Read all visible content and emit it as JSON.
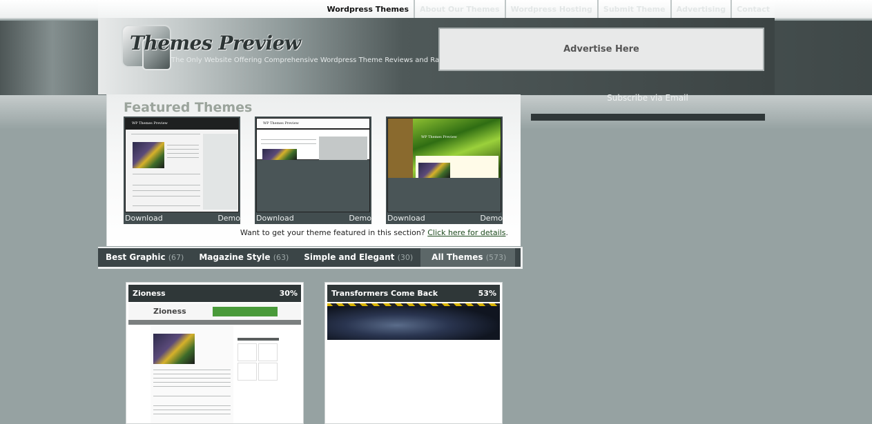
{
  "top_nav": {
    "items": [
      {
        "label": "Wordpress Themes",
        "active": true
      },
      {
        "label": "About Our Themes",
        "active": false
      },
      {
        "label": "Wordpress Hosting",
        "active": false
      },
      {
        "label": "Submit Theme",
        "active": false
      },
      {
        "label": "Advertising",
        "active": false
      },
      {
        "label": "Contact",
        "active": false
      }
    ]
  },
  "header": {
    "logo_title": "Themes Preview",
    "tagline": "The Only Website Offering Comprehensive Wordpress Theme Reviews and Ratings",
    "advert": "Advertise Here"
  },
  "featured": {
    "title": "Featured Themes",
    "cards": [
      {
        "download": "Download",
        "demo": "Demo",
        "shot_title": "WP Themes Preview"
      },
      {
        "download": "Download",
        "demo": "Demo",
        "shot_title": "WP Themes Preview"
      },
      {
        "download": "Download",
        "demo": "Demo",
        "shot_title": "WP Themes Preview"
      }
    ],
    "note_text": "Want to get your theme featured in this section?",
    "note_link": "Click here for details",
    "note_end": "."
  },
  "tabs": [
    {
      "label": "Best Graphic",
      "count": "(67)",
      "active": false
    },
    {
      "label": "Magazine Style",
      "count": "(63)",
      "active": false
    },
    {
      "label": "Simple and Elegant",
      "count": "(30)",
      "active": false
    },
    {
      "label": "All Themes",
      "count": "(573)",
      "active": true
    }
  ],
  "listings": [
    {
      "name": "Zioness",
      "rating": "30%",
      "shot_logo": "Zioness"
    },
    {
      "name": "Transformers Come Back",
      "rating": "53%"
    }
  ],
  "sidebar": {
    "subscribe": "Subscribe via Email"
  },
  "colors": {
    "page_bg": "#96a2a2",
    "header_dark": "#3c4444",
    "tab_bar": "#3b4547",
    "tab_active": "#5c6768",
    "featured_title": "#9ba49c"
  }
}
